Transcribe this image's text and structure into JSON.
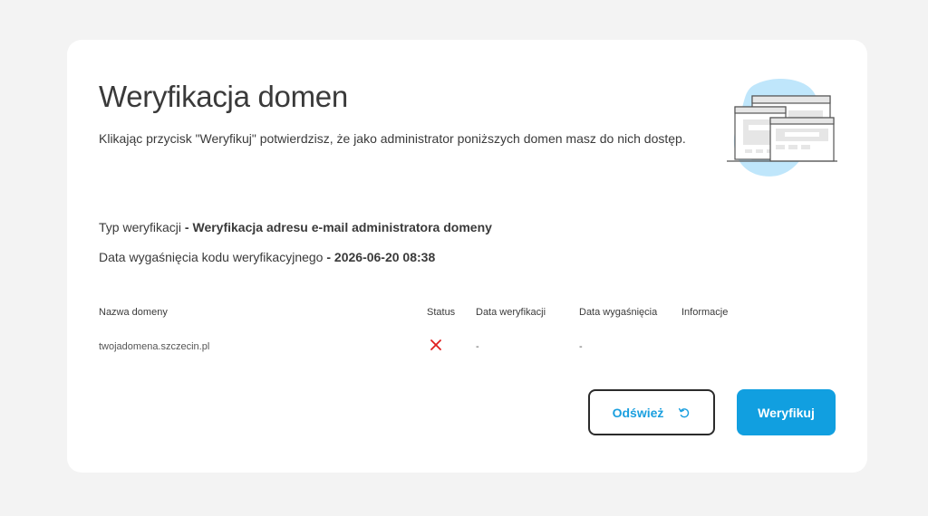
{
  "page": {
    "title": "Weryfikacja domen",
    "subtitle": "Klikając przycisk \"Weryfikuj\" potwierdzisz, że jako administrator poniższych domen masz do nich dostęp."
  },
  "verification": {
    "type_label": "Typ weryfikacji",
    "type_value": "Weryfikacja adresu e-mail administratora domeny",
    "expiry_label": "Data wygaśnięcia kodu weryfikacyjnego",
    "expiry_value": "2026-06-20 08:38",
    "separator": " - "
  },
  "table": {
    "columns": [
      "Nazwa domeny",
      "Status",
      "Data weryfikacji",
      "Data wygaśnięcia",
      "Informacje"
    ],
    "rows": [
      {
        "domain": "twojadomena.szczecin.pl",
        "status_icon": "cross-icon",
        "verified_date": "-",
        "expiry_date": "-",
        "info": ""
      }
    ]
  },
  "buttons": {
    "refresh_label": "Odśwież",
    "verify_label": "Weryfikuj"
  },
  "colors": {
    "accent": "#119fe0",
    "status_error": "#e02020",
    "illustration_blob": "#bfe6fb"
  }
}
